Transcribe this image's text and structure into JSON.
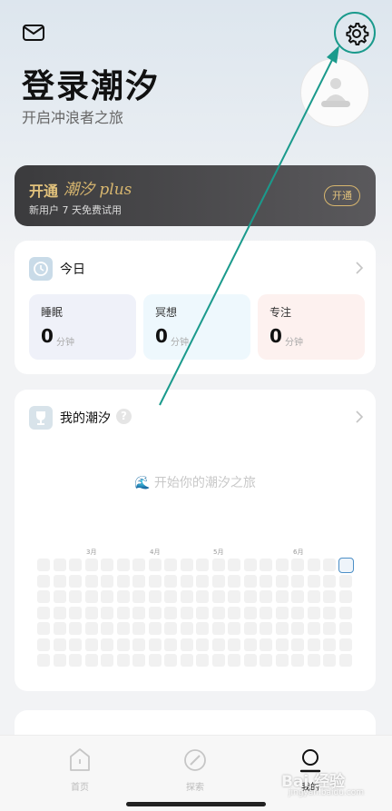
{
  "header": {
    "title": "登录潮汐",
    "subtitle": "开启冲浪者之旅"
  },
  "plus": {
    "title": "开通",
    "brand": "潮汐 plus",
    "subtitle": "新用户 7 天免费试用",
    "button": "开通"
  },
  "today": {
    "title": "今日",
    "stats": [
      {
        "label": "睡眠",
        "value": "0",
        "unit": "分钟",
        "color": "#eff1f9"
      },
      {
        "label": "冥想",
        "value": "0",
        "unit": "分钟",
        "color": "#eef8fd"
      },
      {
        "label": "专注",
        "value": "0",
        "unit": "分钟",
        "color": "#fdf1ef"
      }
    ]
  },
  "tide": {
    "title": "我的潮汐",
    "help": "?",
    "empty_hint": "🌊 开始你的潮汐之旅",
    "months": [
      "3月",
      "4月",
      "5月",
      "6月"
    ]
  },
  "tabs": [
    {
      "label": "首页",
      "icon": "home-icon"
    },
    {
      "label": "探索",
      "icon": "compass-icon"
    },
    {
      "label": "我的",
      "icon": "profile-icon"
    }
  ],
  "watermark": {
    "text": "Bai 经验",
    "sub": "jingyan.baidu.com"
  },
  "colors": {
    "accent_annotation": "#1a9a8c",
    "plus_gold": "#e2c27c"
  }
}
